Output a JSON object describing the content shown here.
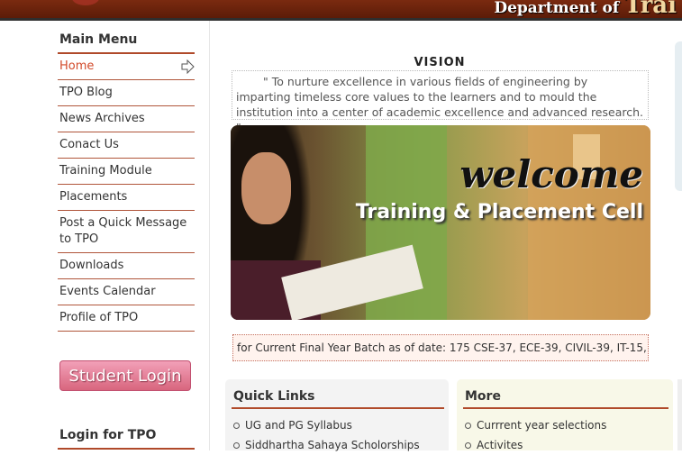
{
  "header": {
    "department_text": "Department of",
    "department_big": "Trai"
  },
  "sidebar": {
    "menu_title": "Main Menu",
    "items": [
      {
        "label": "Home"
      },
      {
        "label": "TPO Blog"
      },
      {
        "label": "News Archives"
      },
      {
        "label": "Conact Us"
      },
      {
        "label": "Training Module"
      },
      {
        "label": "Placements"
      },
      {
        "label": "Post a Quick Message to TPO"
      },
      {
        "label": "Downloads"
      },
      {
        "label": "Events Calendar"
      },
      {
        "label": "Profile of TPO"
      }
    ],
    "student_login": "Student Login",
    "tpo_login_title": "Login for TPO"
  },
  "vision": {
    "title": "VISION",
    "text": "\" To nurture excellence in various fields of engineering by imparting timeless core values to the learners and to mould the institution into a center of academic excellence and advanced research. \""
  },
  "banner": {
    "welcome": "welcome",
    "subtitle": "Training & Placement Cell"
  },
  "ticker": {
    "text": "for Current Final Year Batch as of date: 175 CSE-37, ECE-39, CIVIL-39, IT-15, E"
  },
  "quick_links": {
    "title": "Quick Links",
    "items": [
      "UG and PG Syllabus",
      "Siddhartha Sahaya Scholorships"
    ]
  },
  "more": {
    "title": "More",
    "items": [
      "Currrent year selections",
      "Activites"
    ]
  },
  "colors": {
    "accent": "#b04a2a",
    "active_link": "#d24a2a",
    "header_bg": "#6a2410",
    "login_button": "#e07a92"
  },
  "icons": {
    "active_item_indicator": "arrow-right-icon"
  }
}
